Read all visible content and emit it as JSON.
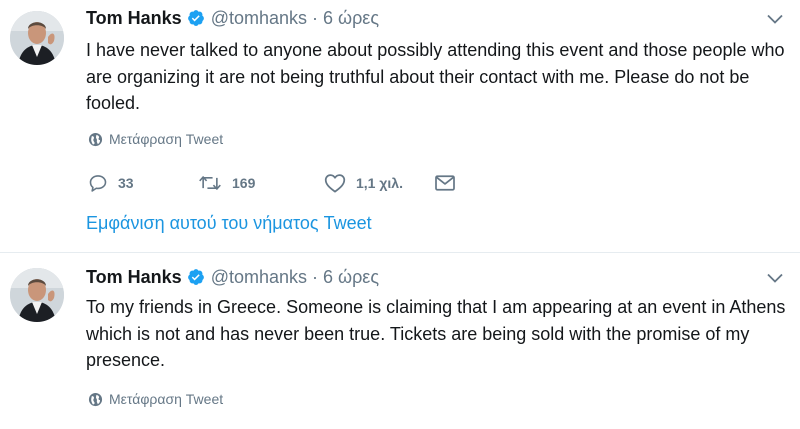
{
  "colors": {
    "link": "#1b95e0",
    "muted": "#657786",
    "text": "#14171a",
    "verified": "#1da1f2",
    "divider": "#e6ecf0"
  },
  "tweets": [
    {
      "name": "Tom Hanks",
      "handle": "@tomhanks",
      "separator": "·",
      "time": "6 ώρες",
      "text": "I have never talked to anyone about possibly attending this event and those people who are organizing it are not being truthful about their contact with me. Please do not be fooled.",
      "translate_label": "Μετάφραση Tweet",
      "replies": "33",
      "retweets": "169",
      "likes": "1,1 χιλ.",
      "show_thread": "Εμφάνιση αυτού του νήματος Tweet"
    },
    {
      "name": "Tom Hanks",
      "handle": "@tomhanks",
      "separator": "·",
      "time": "6 ώρες",
      "text": "To my friends in Greece. Someone is claiming that I am appearing at an event in Athens which is not and has never been true. Tickets are being sold with the promise of my presence.",
      "translate_label": "Μετάφραση Tweet"
    }
  ],
  "icons": {
    "verified": "verified-badge-icon",
    "caret": "chevron-down-icon",
    "globe": "globe-icon",
    "reply": "reply-icon",
    "retweet": "retweet-icon",
    "like": "heart-icon",
    "dm": "envelope-icon"
  }
}
